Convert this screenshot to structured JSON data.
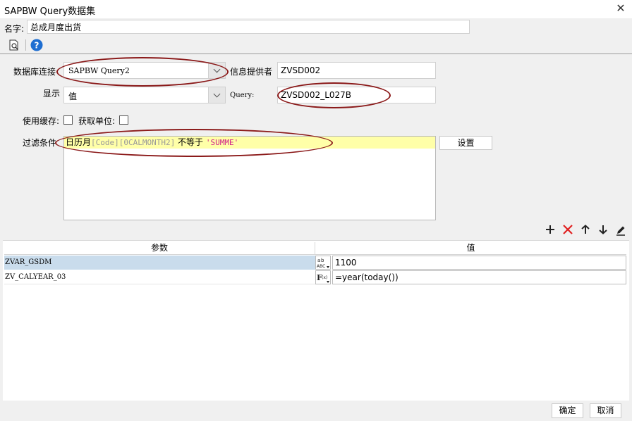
{
  "window": {
    "title": "SAPBW Query数据集"
  },
  "name_row": {
    "label": "名字:",
    "value": "总成月度出货"
  },
  "toolbar": {
    "preview_icon": "preview-icon",
    "help_icon": "help-icon"
  },
  "form": {
    "db_label": "数据库连接",
    "db_value": "SAPBW Query2",
    "provider_label": "信息提供者",
    "provider_value": "ZVSD002",
    "display_label": "显示",
    "display_value": "值",
    "query_label": "Query:",
    "query_value": "ZVSD002_L027B",
    "use_cache_label": "使用缓存:",
    "get_unit_label": "获取单位:",
    "filter_label": "过滤条件",
    "filter": {
      "part1": "日历月",
      "part2": "[Code][0CALMONTH2]",
      "part3": " 不等于 ",
      "part4": "'SUMME'"
    },
    "settings_button": "设置"
  },
  "param_toolbar": [
    "add-icon",
    "delete-icon",
    "move-up-icon",
    "move-down-icon",
    "edit-icon"
  ],
  "table": {
    "columns": [
      "参数",
      "值"
    ],
    "rows": [
      {
        "param": "ZVAR_GSDM",
        "type_icon": "abc",
        "value": "1100"
      },
      {
        "param": "ZV_CALYEAR_03",
        "type_icon": "F(x)",
        "value": "=year(today())"
      }
    ]
  },
  "footer": {
    "ok": "确定",
    "cancel": "取消"
  },
  "colors": {
    "annotation": "#8b1a1a",
    "filter_bg": "#ffffa8",
    "selected_row": "#c9dcec"
  }
}
